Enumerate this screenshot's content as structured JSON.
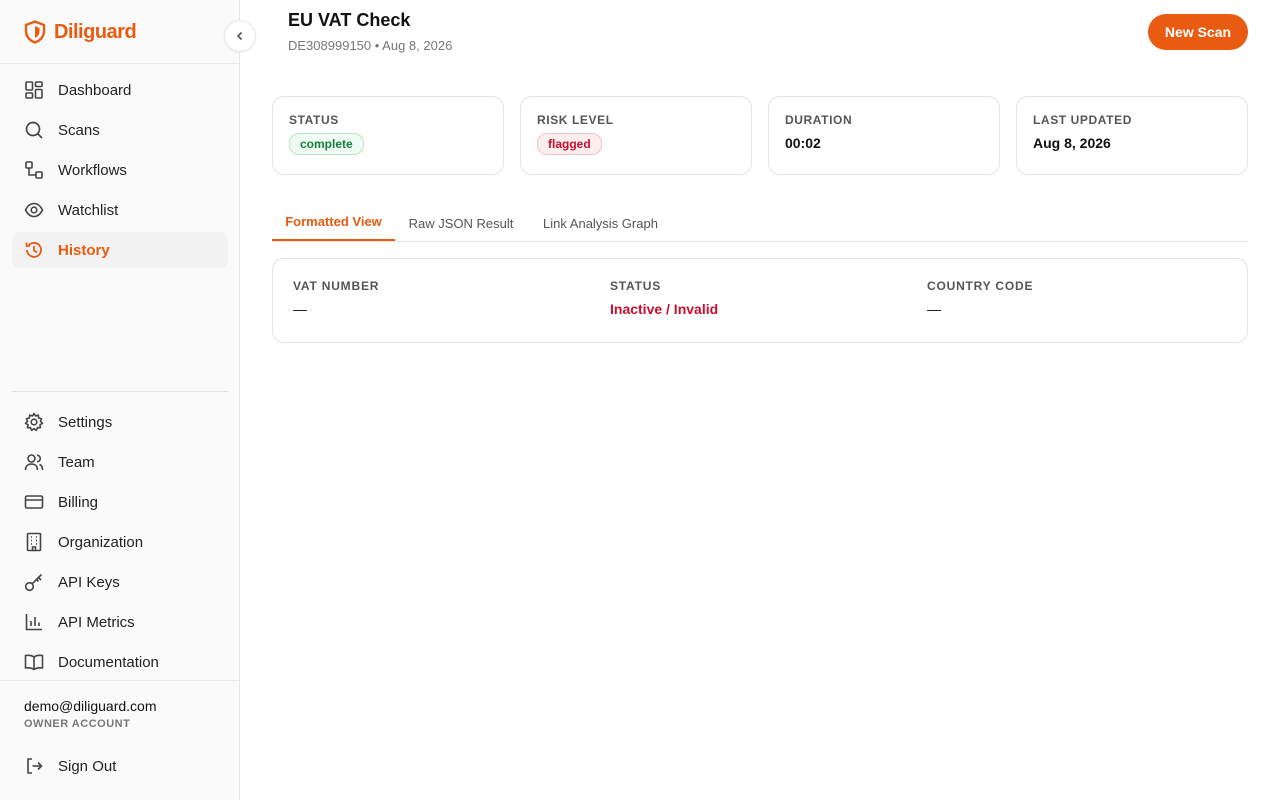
{
  "app": {
    "brand": "Diliguard",
    "accent": "#e85b10"
  },
  "sidebar": {
    "primary_items": [
      {
        "label": "Dashboard",
        "icon": "dashboard-icon"
      },
      {
        "label": "Scans",
        "icon": "search-icon"
      },
      {
        "label": "Workflows",
        "icon": "workflow-icon"
      },
      {
        "label": "Watchlist",
        "icon": "eye-icon"
      },
      {
        "label": "History",
        "icon": "history-icon",
        "active": true
      }
    ],
    "secondary_items": [
      {
        "label": "Settings",
        "icon": "gear-icon"
      },
      {
        "label": "Team",
        "icon": "users-icon"
      },
      {
        "label": "Billing",
        "icon": "credit-card-icon"
      },
      {
        "label": "Organization",
        "icon": "building-icon"
      },
      {
        "label": "API Keys",
        "icon": "key-icon"
      },
      {
        "label": "API Metrics",
        "icon": "bar-chart-icon"
      },
      {
        "label": "Documentation",
        "icon": "book-icon"
      }
    ],
    "user": {
      "email": "demo@diliguard.com",
      "role": "OWNER ACCOUNT"
    },
    "sign_out": "Sign Out"
  },
  "header": {
    "title": "EU VAT Check",
    "subtitle": "DE308999150 • Aug 8, 2026",
    "new_scan_label": "New Scan"
  },
  "summary": {
    "status": {
      "label": "STATUS",
      "value": "complete"
    },
    "risk": {
      "label": "RISK LEVEL",
      "value": "flagged"
    },
    "duration": {
      "label": "DURATION",
      "value": "00:02"
    },
    "updated": {
      "label": "LAST UPDATED",
      "value": "Aug 8, 2026"
    }
  },
  "tabs": [
    {
      "label": "Formatted View",
      "active": true
    },
    {
      "label": "Raw JSON Result"
    },
    {
      "label": "Link Analysis Graph"
    }
  ],
  "result": {
    "vat_number": {
      "label": "VAT NUMBER",
      "value": "—"
    },
    "status": {
      "label": "STATUS",
      "value": "Inactive / Invalid",
      "color": "#c8102e"
    },
    "country_code": {
      "label": "COUNTRY CODE",
      "value": "—"
    }
  }
}
